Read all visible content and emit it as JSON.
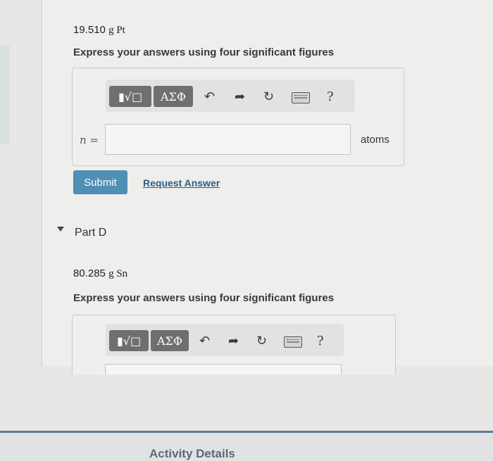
{
  "part_c": {
    "quantity": "19.510",
    "unit": "g Pt",
    "instruction": "Express your answers using four significant figures",
    "variable": "n =",
    "answer_value": "",
    "answer_unit": "atoms",
    "toolbar": {
      "template_btn": "▮√□",
      "symbol_btn": "ΑΣΦ",
      "undo": "↶",
      "redo": "➦",
      "reset": "↻",
      "help": "?"
    },
    "submit_label": "Submit",
    "request_label": "Request Answer"
  },
  "part_d": {
    "title": "Part D",
    "quantity": "80.285",
    "unit": "g Sn",
    "instruction": "Express your answers using four significant figures",
    "toolbar": {
      "template_btn": "▮√□",
      "symbol_btn": "ΑΣΦ",
      "undo": "↶",
      "redo": "➦",
      "reset": "↻",
      "help": "?"
    }
  },
  "footer": {
    "activity_label": "Activity Details"
  }
}
